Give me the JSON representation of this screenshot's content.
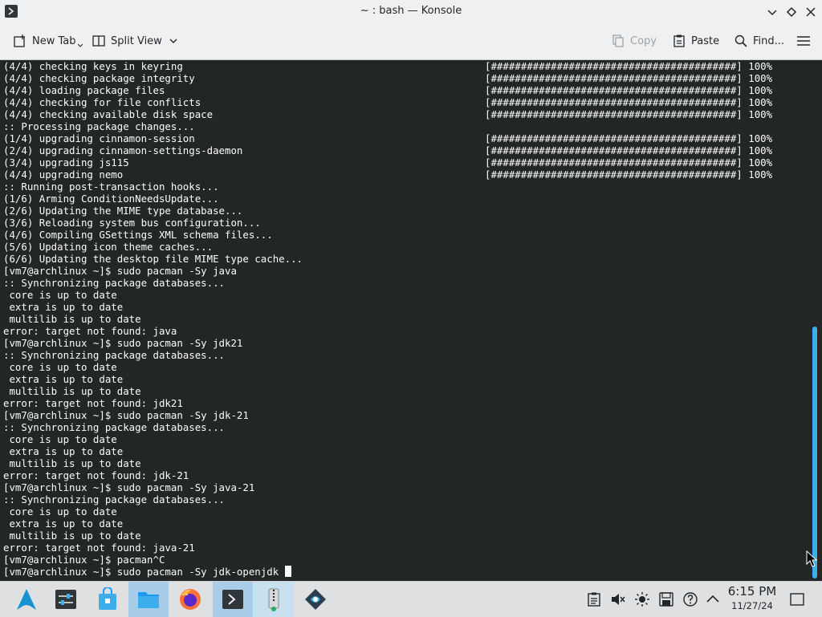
{
  "window": {
    "title": "~ : bash — Konsole"
  },
  "toolbar": {
    "new_tab": "New Tab",
    "split_view": "Split View",
    "copy": "Copy",
    "paste": "Paste",
    "find": "Find..."
  },
  "terminal": {
    "lines": [
      "(4/4) checking keys in keyring",
      "(4/4) checking package integrity",
      "(4/4) loading package files",
      "(4/4) checking for file conflicts",
      "(4/4) checking available disk space",
      ":: Processing package changes...",
      "(1/4) upgrading cinnamon-session",
      "(2/4) upgrading cinnamon-settings-daemon",
      "(3/4) upgrading js115",
      "(4/4) upgrading nemo",
      ":: Running post-transaction hooks...",
      "(1/6) Arming ConditionNeedsUpdate...",
      "(2/6) Updating the MIME type database...",
      "(3/6) Reloading system bus configuration...",
      "(4/6) Compiling GSettings XML schema files...",
      "(5/6) Updating icon theme caches...",
      "(6/6) Updating the desktop file MIME type cache...",
      "[vm7@archlinux ~]$ sudo pacman -Sy java",
      ":: Synchronizing package databases...",
      " core is up to date",
      " extra is up to date",
      " multilib is up to date",
      "error: target not found: java",
      "[vm7@archlinux ~]$ sudo pacman -Sy jdk21",
      ":: Synchronizing package databases...",
      " core is up to date",
      " extra is up to date",
      " multilib is up to date",
      "error: target not found: jdk21",
      "[vm7@archlinux ~]$ sudo pacman -Sy jdk-21",
      ":: Synchronizing package databases...",
      " core is up to date",
      " extra is up to date",
      " multilib is up to date",
      "error: target not found: jdk-21",
      "[vm7@archlinux ~]$ sudo pacman -Sy java-21",
      ":: Synchronizing package databases...",
      " core is up to date",
      " extra is up to date",
      " multilib is up to date",
      "error: target not found: java-21",
      "[vm7@archlinux ~]$ pacman^C",
      "[vm7@archlinux ~]$ sudo pacman -Sy jdk-openjdk "
    ],
    "progress_bar": "[#########################################] 100%",
    "progress_rows": [
      0,
      1,
      2,
      3,
      4,
      6,
      7,
      8,
      9
    ]
  },
  "taskbar": {
    "clock_time": "6:15 PM",
    "clock_date": "11/27/24"
  }
}
